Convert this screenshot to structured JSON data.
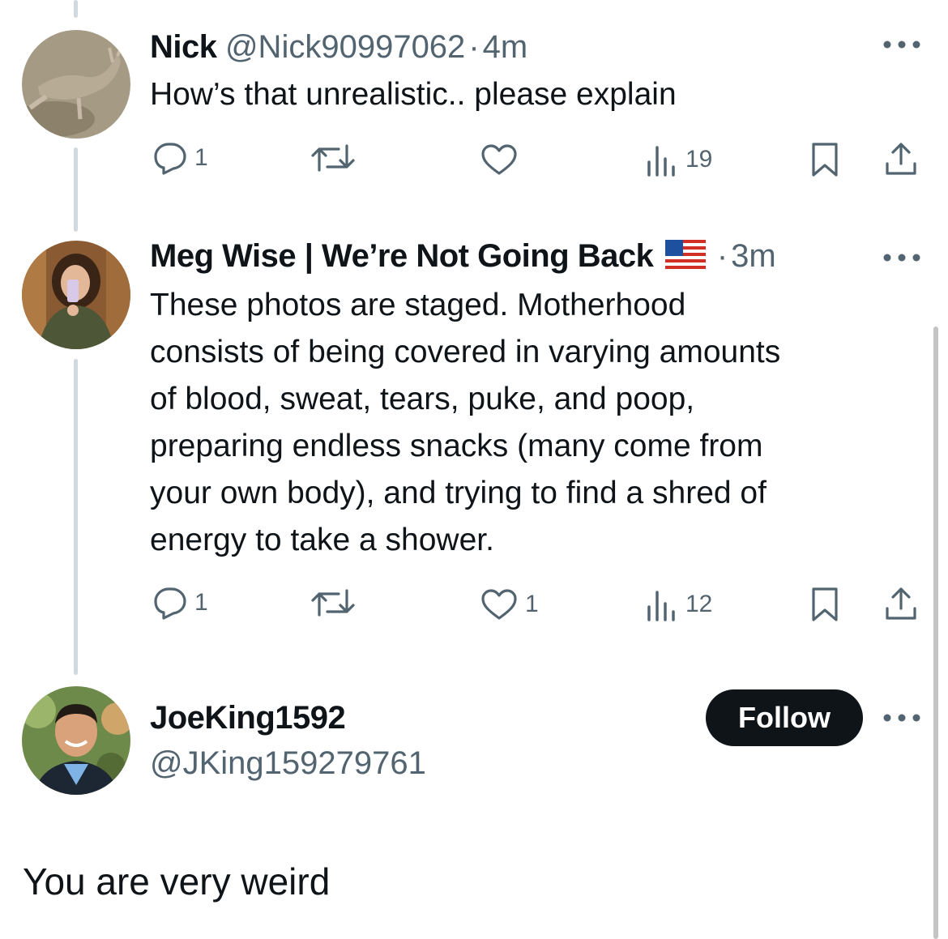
{
  "posts": [
    {
      "name": "Nick",
      "handle": "@Nick90997062",
      "separator": "·",
      "time": "4m",
      "text": "How’s that unrealistic.. please explain",
      "reply_count": "1",
      "like_count": "",
      "view_count": "19",
      "avatar_icon": "kangaroo-photo"
    },
    {
      "name": "Meg Wise | We’re Not Going Back",
      "flag": "🇺🇸",
      "separator": "·",
      "time": "3m",
      "text_lines": [
        "These photos are staged. Motherhood",
        "consists of being covered in varying amounts",
        "of blood, sweat, tears, puke, and poop,",
        "preparing endless snacks (many come from",
        "your own body), and trying to find a shred of",
        "energy to take a shower."
      ],
      "reply_count": "1",
      "like_count": "1",
      "view_count": "12",
      "avatar_icon": "woman-selfie-photo"
    }
  ],
  "profile": {
    "name": "JoeKing1592",
    "handle": "@JKing159279761",
    "follow_label": "Follow",
    "avatar_icon": "man-portrait-photo"
  },
  "reply_draft": "You are very weird",
  "colors": {
    "text": "#0f1419",
    "secondary": "#536471",
    "thread_line": "#cfd9de",
    "follow_bg": "#0f1419"
  }
}
